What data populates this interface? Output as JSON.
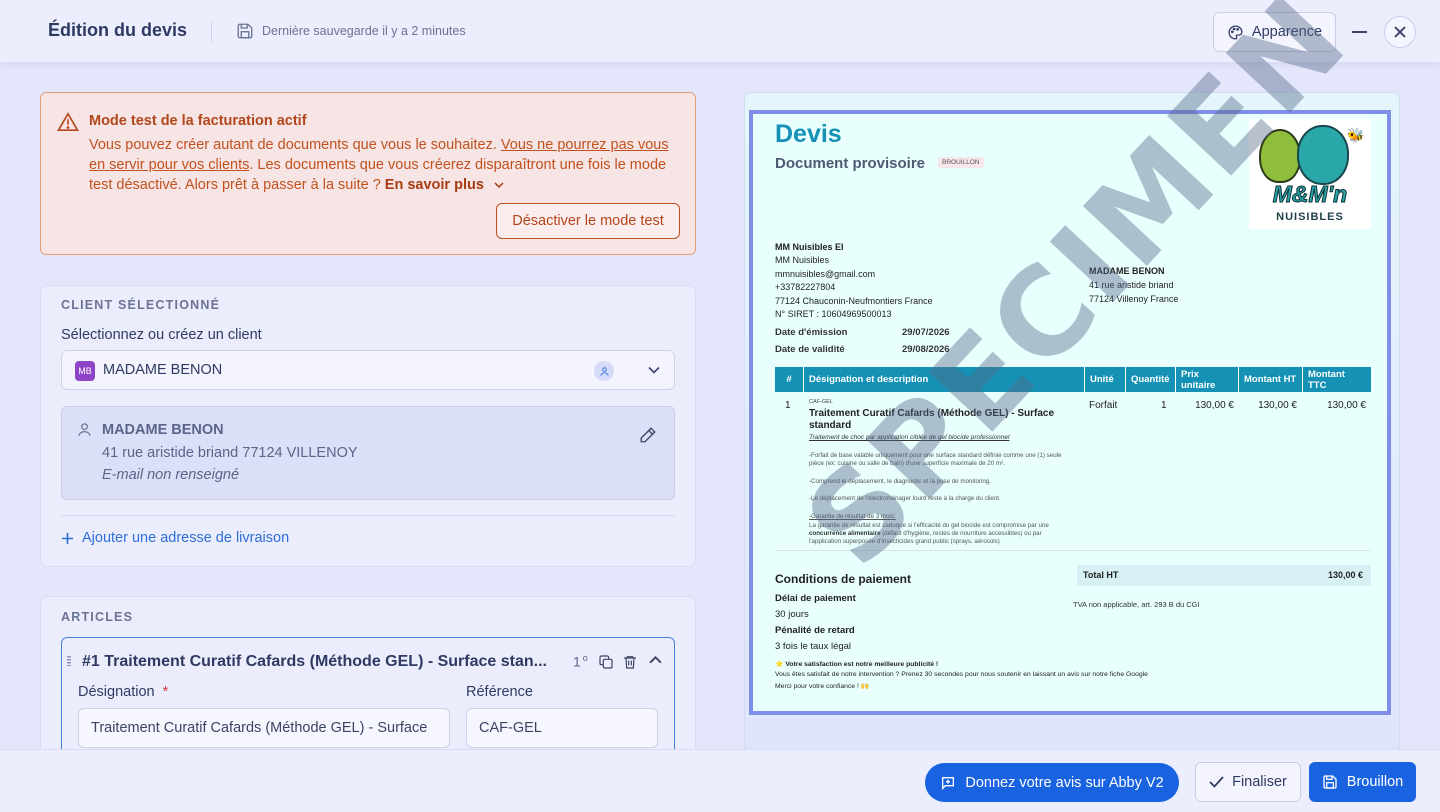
{
  "header": {
    "title": "Édition du devis",
    "last_save": "Dernière sauvegarde il y a 2 minutes",
    "appearance_label": "Apparence"
  },
  "alert": {
    "title": "Mode test de la facturation actif",
    "text_1": "Vous pouvez créer autant de documents que vous le souhaitez. ",
    "text_link": "Vous ne pourrez pas vous en servir pour vos clients",
    "text_2": ". Les documents que vous créerez disparaîtront une fois le mode test désactivé. Alors prêt à passer à la suite ? ",
    "more_label": "En savoir plus",
    "deactivate_label": "Désactiver le mode test"
  },
  "client": {
    "section_label": "CLIENT SÉLECTIONNÉ",
    "select_label": "Sélectionnez ou créez un client",
    "badge": "MB",
    "selected": "MADAME BENON",
    "name": "MADAME BENON",
    "address": "41 rue aristide briand 77124 VILLENOY",
    "email": "E-mail non renseigné",
    "add_delivery": "Ajouter une adresse de livraison"
  },
  "articles": {
    "section_label": "ARTICLES",
    "item_title": "#1  Traitement Curatif Cafards (Méthode GEL) - Surface stan...",
    "item_qty": "1",
    "item_unit_sup": "o",
    "designation_label": "Désignation",
    "required_mark": "*",
    "reference_label": "Référence",
    "designation_value": "Traitement Curatif Cafards (Méthode GEL) - Surface",
    "reference_value": "CAF-GEL"
  },
  "preview": {
    "title": "Devis",
    "subtitle": "Document provisoire",
    "badge": "BROUILLON",
    "logo_text": "M&M'n",
    "logo_sub": "NUISIBLES",
    "sender": {
      "l1": "MM Nuisibles EI",
      "l2": "MM Nuisibles",
      "l3": "mmnuisibles@gmail.com",
      "l4": "+33782227804",
      "l5": "77124 Chauconin-Neufmontiers France",
      "l6": "N° SIRET : 10604969500013"
    },
    "recipient": {
      "l1": "MADAME BENON",
      "l2": "41 rue aristide briand",
      "l3": "77124 Villenoy France"
    },
    "dates": {
      "emission_label": "Date d'émission",
      "emission": "29/07/2026",
      "validity_label": "Date de validité",
      "validity": "29/08/2026"
    },
    "table": {
      "headers": [
        "#",
        "Désignation et description",
        "Unité",
        "Quantité",
        "Prix unitaire",
        "Montant HT",
        "Montant TTC"
      ],
      "row": {
        "num": "1",
        "ref": "CAF-GEL",
        "title_1": "Traitement Curatif Cafards (Méthode GEL) - Surface",
        "title_2": "standard",
        "unit": "Forfait",
        "qty": "1",
        "pu": "130,00 €",
        "ht": "130,00 €",
        "ttc": "130,00 €",
        "desc_1": "Traitement de choc par application ciblée de gel biocide professionnel",
        "desc_2": "-Forfait de base valable uniquement pour une surface standard définie comme une (1) seule",
        "desc_3": "pièce (ex: cuisine ou salle de bain) d'une superficie maximale de 20 m².",
        "desc_4": "-Comprend le déplacement, le diagnostic et la pose de monitoring.",
        "desc_5": "-Le déplacement de l'électroménager lourd reste à la charge du client.",
        "desc_6": "-Garantie de résultat de 3 mois:",
        "desc_7": "La garantie de résultat est caduque si l'efficacité du gel biocide est compromise par une",
        "desc_8a": "concurrence alimentaire",
        "desc_8b": " (défaut d'hygiène, restes de nourriture accessibles) ou par",
        "desc_9": "l'application superposée d'insecticides grand public (sprays, aérosols)"
      }
    },
    "payment": {
      "title": "Conditions de paiement",
      "delay_label": "Délai de paiement",
      "delay": "30 jours",
      "penalty_label": "Pénalité de retard",
      "penalty": "3 fois le taux légal"
    },
    "totals": {
      "label": "Total HT",
      "value": "130,00 €",
      "tva_note": "TVA non applicable, art. 293 B du CGI"
    },
    "footer": {
      "l1": "⭐ Votre satisfaction est notre meilleure publicité !",
      "l2": "Vous êtes satisfait de notre intervention ? Prenez 30 secondes pour nous soutenir en laissant un avis sur notre fiche Google",
      "l3": "Merci pour votre confiance ! 🙌"
    },
    "watermark": "SPECIMEN"
  },
  "footer_bar": {
    "feedback_label": "Donnez votre avis sur Abby V2",
    "finalize_label": "Finaliser",
    "draft_label": "Brouillon"
  },
  "colors": {
    "primary": "#1a63e0",
    "alert_text": "#c0521f",
    "table_header": "#1591b6",
    "doc_title": "#1591b6"
  }
}
